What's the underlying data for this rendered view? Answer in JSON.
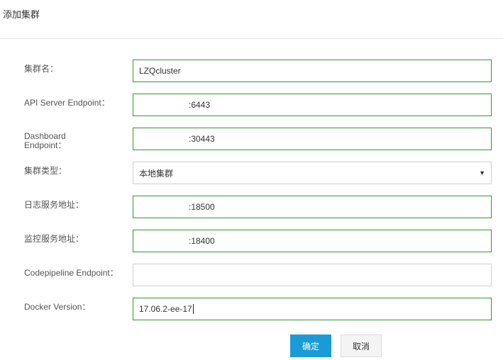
{
  "dialog": {
    "title": "添加集群"
  },
  "form": {
    "cluster_name": {
      "label": "集群名：",
      "value": "LZQcluster"
    },
    "api_server": {
      "label": "API Server Endpoint：",
      "value": ":6443"
    },
    "dashboard": {
      "label_line1": "Dashboard",
      "label_line2": "Endpoint：",
      "value": ":30443"
    },
    "cluster_type": {
      "label": "集群类型：",
      "selected": "本地集群"
    },
    "log_service": {
      "label": "日志服务地址：",
      "value": ":18500"
    },
    "monitor_service": {
      "label": "监控服务地址：",
      "value": ":18400"
    },
    "codepipeline": {
      "label": "Codepipeline Endpoint：",
      "value": ""
    },
    "docker_version": {
      "label": "Docker Version：",
      "value": "17.06.2-ee-17"
    }
  },
  "buttons": {
    "confirm": "确定",
    "cancel": "取消"
  },
  "icons": {
    "select_arrow": "▼"
  },
  "colors": {
    "primary": "#1a9bd7",
    "field_border_valid": "#2e9a2e"
  }
}
